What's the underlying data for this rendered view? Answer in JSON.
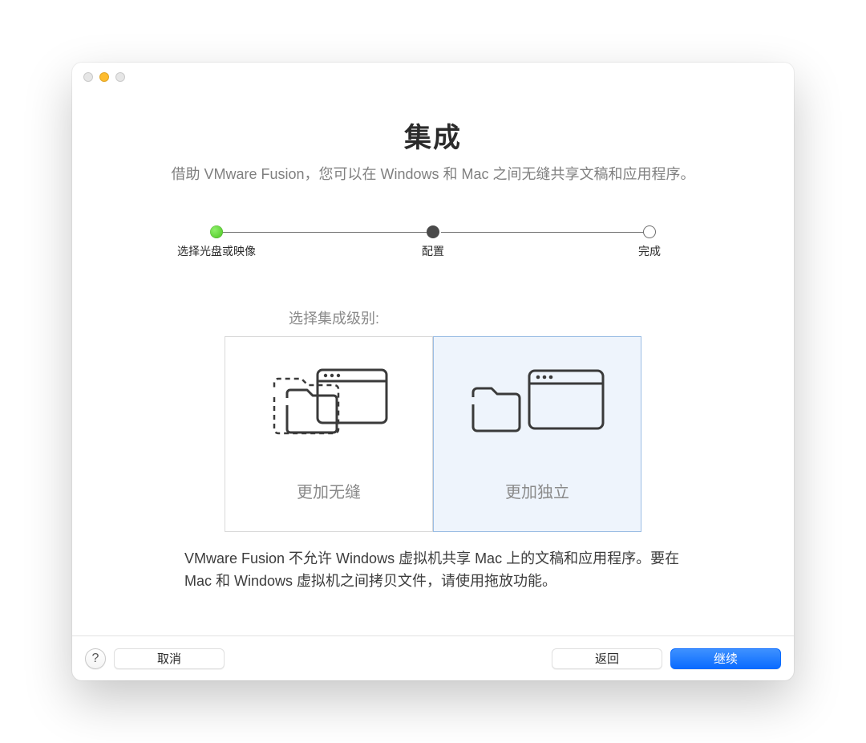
{
  "header": {
    "title": "集成",
    "subtitle": "借助 VMware Fusion，您可以在 Windows 和 Mac 之间无缝共享文稿和应用程序。"
  },
  "stepper": {
    "steps": [
      {
        "label": "选择光盘或映像",
        "state": "done"
      },
      {
        "label": "配置",
        "state": "current"
      },
      {
        "label": "完成",
        "state": "todo"
      }
    ]
  },
  "section_label": "选择集成级别:",
  "choices": [
    {
      "id": "seamless",
      "label": "更加无缝",
      "selected": false
    },
    {
      "id": "isolated",
      "label": "更加独立",
      "selected": true
    }
  ],
  "description": "VMware Fusion 不允许 Windows 虚拟机共享 Mac 上的文稿和应用程序。要在 Mac 和 Windows 虚拟机之间拷贝文件，请使用拖放功能。",
  "footer": {
    "help": "?",
    "cancel": "取消",
    "back": "返回",
    "continue": "继续"
  }
}
